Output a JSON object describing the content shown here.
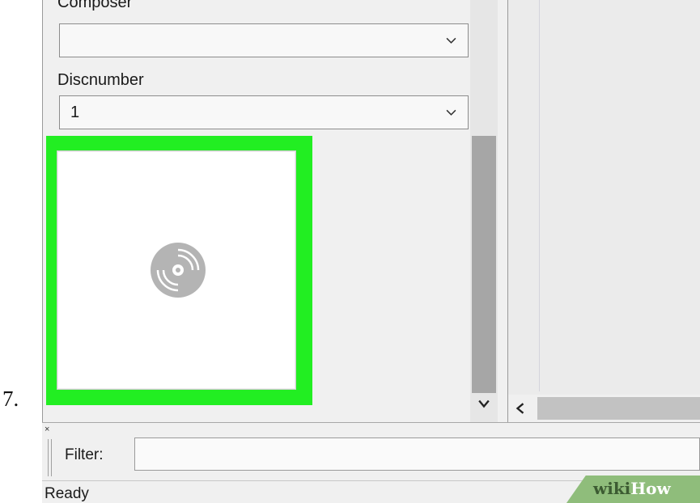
{
  "step": {
    "number": "7."
  },
  "tag_panel": {
    "composer": {
      "label": "Composer",
      "value": ""
    },
    "discnumber": {
      "label": "Discnumber",
      "value": "1"
    },
    "artwork": {
      "highlight_color": "#22ee22",
      "placeholder_icon": "disc-icon"
    }
  },
  "filter": {
    "label": "Filter:",
    "value": ""
  },
  "status": {
    "text": "Ready"
  },
  "watermark": {
    "part1": "wiki",
    "part2": "How"
  }
}
